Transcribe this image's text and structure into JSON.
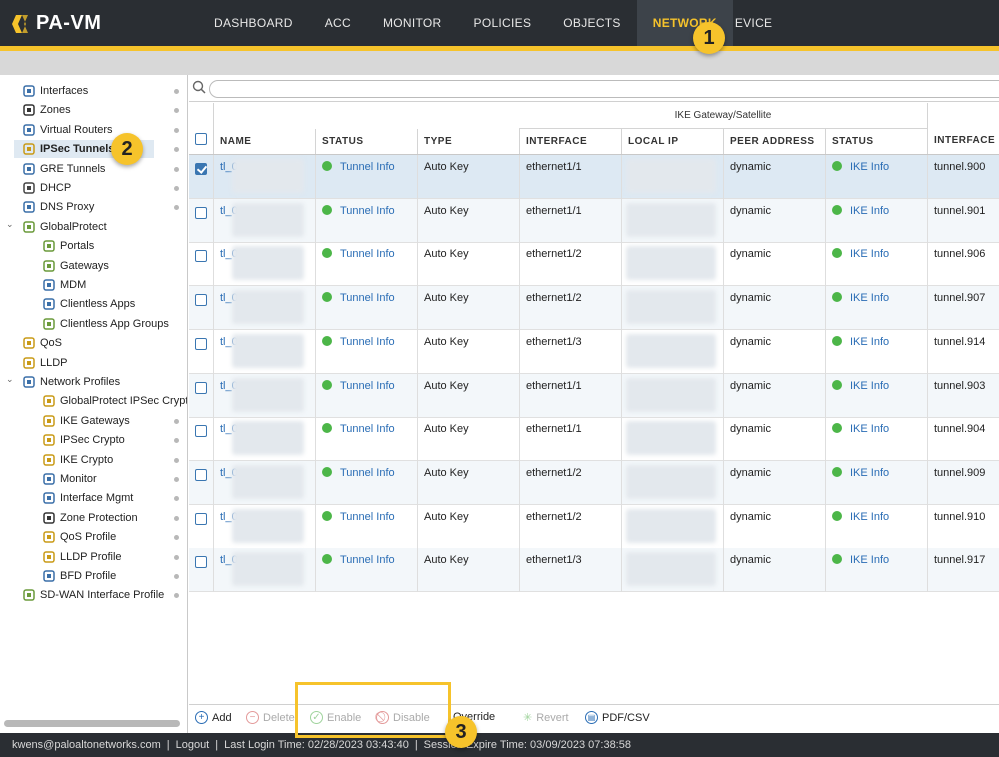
{
  "app": {
    "name": "PA-VM"
  },
  "nav": [
    "DASHBOARD",
    "ACC",
    "MONITOR",
    "POLICIES",
    "OBJECTS",
    "NETWORK",
    "EVICE"
  ],
  "nav_active": "NETWORK",
  "sidebar": {
    "items": [
      {
        "label": "Interfaces",
        "icon": "interfaces-icon"
      },
      {
        "label": "Zones",
        "icon": "zones-icon"
      },
      {
        "label": "Virtual Routers",
        "icon": "virtual-routers-icon"
      },
      {
        "label": "IPSec Tunnels",
        "icon": "lock-icon"
      },
      {
        "label": "GRE Tunnels",
        "icon": "gre-tunnels-icon"
      },
      {
        "label": "DHCP",
        "icon": "dhcp-icon"
      },
      {
        "label": "DNS Proxy",
        "icon": "dns-icon"
      },
      {
        "label": "GlobalProtect",
        "icon": "globe-icon"
      },
      {
        "label": "Portals",
        "icon": "globe-icon"
      },
      {
        "label": "Gateways",
        "icon": "globe-icon"
      },
      {
        "label": "MDM",
        "icon": "mdm-icon"
      },
      {
        "label": "Clientless Apps",
        "icon": "apps-icon"
      },
      {
        "label": "Clientless App Groups",
        "icon": "globe-icon"
      },
      {
        "label": "QoS",
        "icon": "qos-icon"
      },
      {
        "label": "LLDP",
        "icon": "lldp-icon"
      },
      {
        "label": "Network Profiles",
        "icon": "profiles-icon"
      },
      {
        "label": "GlobalProtect IPSec Crypto",
        "icon": "lock-icon"
      },
      {
        "label": "IKE Gateways",
        "icon": "gateway-icon"
      },
      {
        "label": "IPSec Crypto",
        "icon": "lock-icon"
      },
      {
        "label": "IKE Crypto",
        "icon": "lock-icon"
      },
      {
        "label": "Monitor",
        "icon": "monitor-icon"
      },
      {
        "label": "Interface Mgmt",
        "icon": "mgmt-icon"
      },
      {
        "label": "Zone Protection",
        "icon": "shield-icon"
      },
      {
        "label": "QoS Profile",
        "icon": "qos-icon"
      },
      {
        "label": "LLDP Profile",
        "icon": "lldp-icon"
      },
      {
        "label": "BFD Profile",
        "icon": "bfd-icon"
      },
      {
        "label": "SD-WAN Interface Profile",
        "icon": "sdwan-icon"
      }
    ]
  },
  "table": {
    "group_header": "IKE Gateway/Satellite",
    "columns": [
      "NAME",
      "STATUS",
      "TYPE",
      "INTERFACE",
      "LOCAL IP",
      "PEER ADDRESS",
      "STATUS",
      "INTERFACE"
    ],
    "rows": [
      {
        "name": "tl_0",
        "status": "Tunnel Info",
        "type": "Auto Key",
        "interface": "ethernet1/1",
        "peer": "dynamic",
        "ike": "IKE Info",
        "tunnel": "tunnel.900",
        "checked": true
      },
      {
        "name": "tl_0",
        "status": "Tunnel Info",
        "type": "Auto Key",
        "interface": "ethernet1/1",
        "peer": "dynamic",
        "ike": "IKE Info",
        "tunnel": "tunnel.901",
        "checked": false
      },
      {
        "name": "tl_0",
        "status": "Tunnel Info",
        "type": "Auto Key",
        "interface": "ethernet1/2",
        "peer": "dynamic",
        "ike": "IKE Info",
        "tunnel": "tunnel.906",
        "checked": false
      },
      {
        "name": "tl_0",
        "status": "Tunnel Info",
        "type": "Auto Key",
        "interface": "ethernet1/2",
        "peer": "dynamic",
        "ike": "IKE Info",
        "tunnel": "tunnel.907",
        "checked": false
      },
      {
        "name": "tl_0",
        "status": "Tunnel Info",
        "type": "Auto Key",
        "interface": "ethernet1/3",
        "peer": "dynamic",
        "ike": "IKE Info",
        "tunnel": "tunnel.914",
        "checked": false
      },
      {
        "name": "tl_0",
        "status": "Tunnel Info",
        "type": "Auto Key",
        "interface": "ethernet1/1",
        "peer": "dynamic",
        "ike": "IKE Info",
        "tunnel": "tunnel.903",
        "checked": false
      },
      {
        "name": "tl_0",
        "status": "Tunnel Info",
        "type": "Auto Key",
        "interface": "ethernet1/1",
        "peer": "dynamic",
        "ike": "IKE Info",
        "tunnel": "tunnel.904",
        "checked": false
      },
      {
        "name": "tl_0",
        "status": "Tunnel Info",
        "type": "Auto Key",
        "interface": "ethernet1/2",
        "peer": "dynamic",
        "ike": "IKE Info",
        "tunnel": "tunnel.909",
        "checked": false
      },
      {
        "name": "tl_0",
        "status": "Tunnel Info",
        "type": "Auto Key",
        "interface": "ethernet1/2",
        "peer": "dynamic",
        "ike": "IKE Info",
        "tunnel": "tunnel.910",
        "checked": false
      },
      {
        "name": "tl_0",
        "status": "Tunnel Info",
        "type": "Auto Key",
        "interface": "ethernet1/3",
        "peer": "dynamic",
        "ike": "IKE Info",
        "tunnel": "tunnel.917",
        "checked": false
      }
    ]
  },
  "toolbar": {
    "add": "Add",
    "delete": "Delete",
    "enable": "Enable",
    "disable": "Disable",
    "override": "Override",
    "revert": "Revert",
    "pdf": "PDF/CSV"
  },
  "status_bar": {
    "user": "kwens@paloaltonetworks.com",
    "logout": "Logout",
    "last_login": "Last Login Time: 02/28/2023 03:43:40",
    "session": "Session Expire Time: 03/09/2023 07:38:58"
  },
  "callouts": [
    "1",
    "2",
    "3"
  ],
  "colors": {
    "accent": "#f6c32b",
    "topbar": "#2a2e33",
    "link": "#2a6db5",
    "ok": "#4cb648"
  }
}
